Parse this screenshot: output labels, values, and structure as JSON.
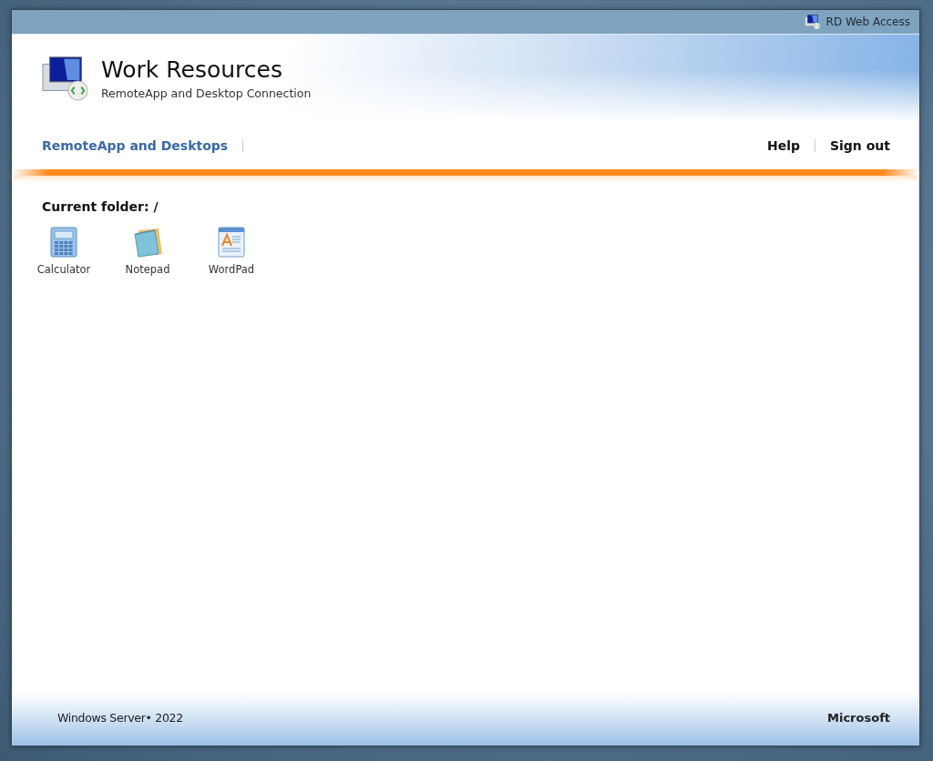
{
  "top_bar": {
    "title": "RD Web Access"
  },
  "header": {
    "title": "Work Resources",
    "subtitle": "RemoteApp and Desktop Connection"
  },
  "tabs": [
    {
      "label": "RemoteApp and Desktops",
      "selected": true
    }
  ],
  "links": [
    "Help",
    "Sign out"
  ],
  "folder": {
    "label": "Current folder: /"
  },
  "apps": [
    {
      "name": "Calculator",
      "kind": "calculator"
    },
    {
      "name": "Notepad",
      "kind": "notepad"
    },
    {
      "name": "WordPad",
      "kind": "wordpad"
    }
  ],
  "footer": {
    "product": "Windows Server• 2022",
    "brand": "Microsoft"
  }
}
